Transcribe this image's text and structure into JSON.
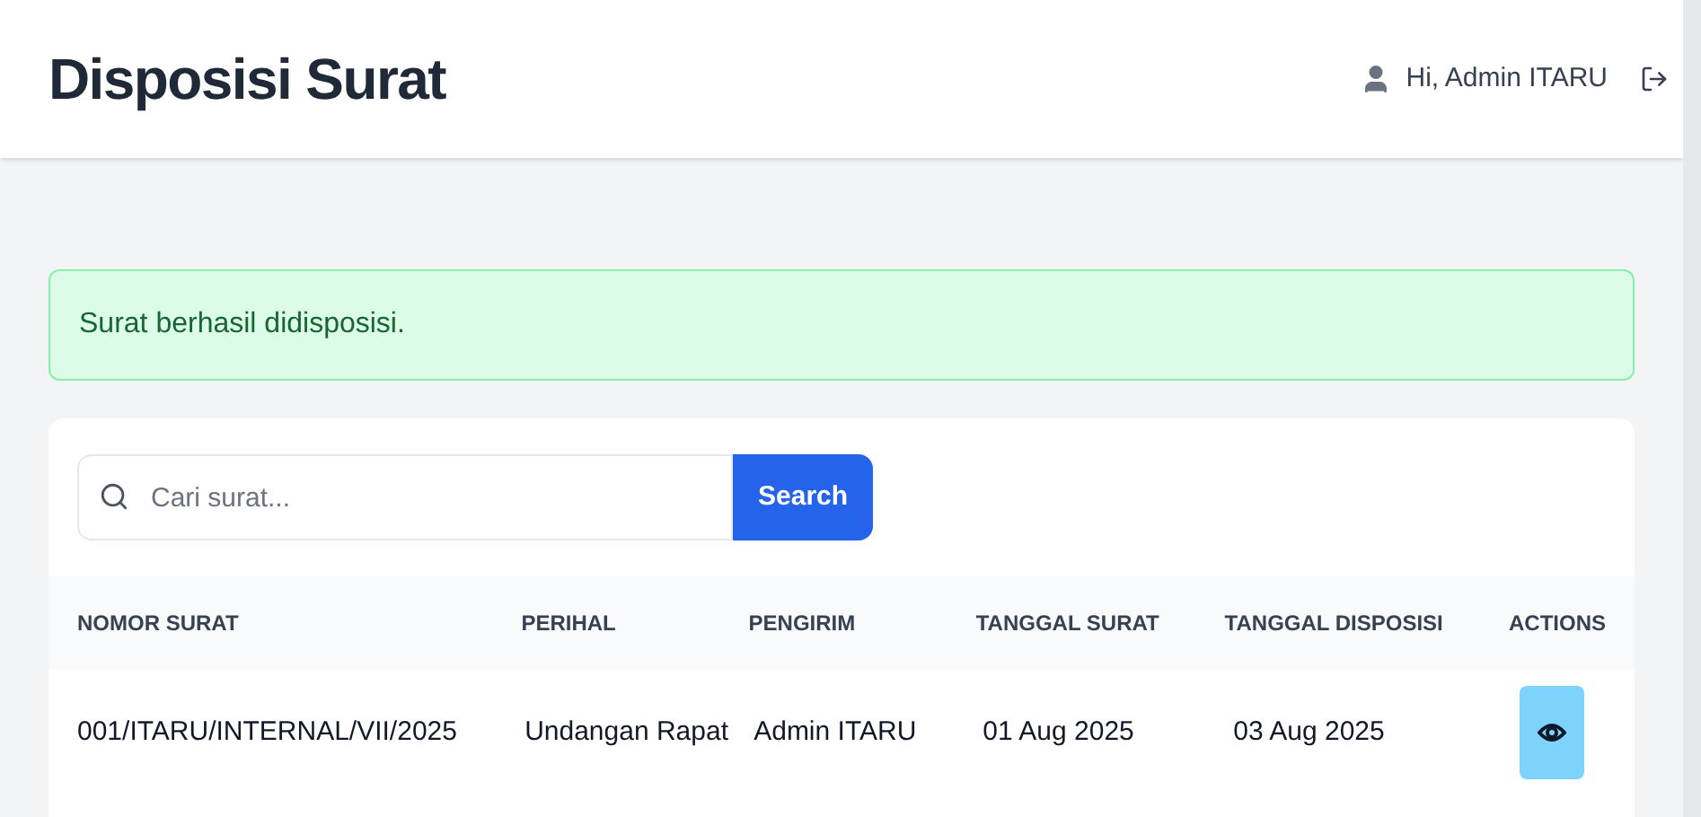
{
  "header": {
    "title": "Disposisi Surat",
    "user_greeting": "Hi, Admin ITARU"
  },
  "alert": {
    "message": "Surat berhasil didisposisi."
  },
  "search": {
    "placeholder": "Cari surat...",
    "button": "Search"
  },
  "table": {
    "columns": [
      "NOMOR SURAT",
      "PERIHAL",
      "PENGIRIM",
      "TANGGAL SURAT",
      "TANGGAL DISPOSISI",
      "ACTIONS"
    ],
    "rows": [
      {
        "cells": [
          "001/ITARU/INTERNAL/VII/2025",
          "Undangan Rapat",
          "Admin ITARU",
          "01 Aug 2025",
          "03 Aug 2025"
        ]
      }
    ]
  }
}
